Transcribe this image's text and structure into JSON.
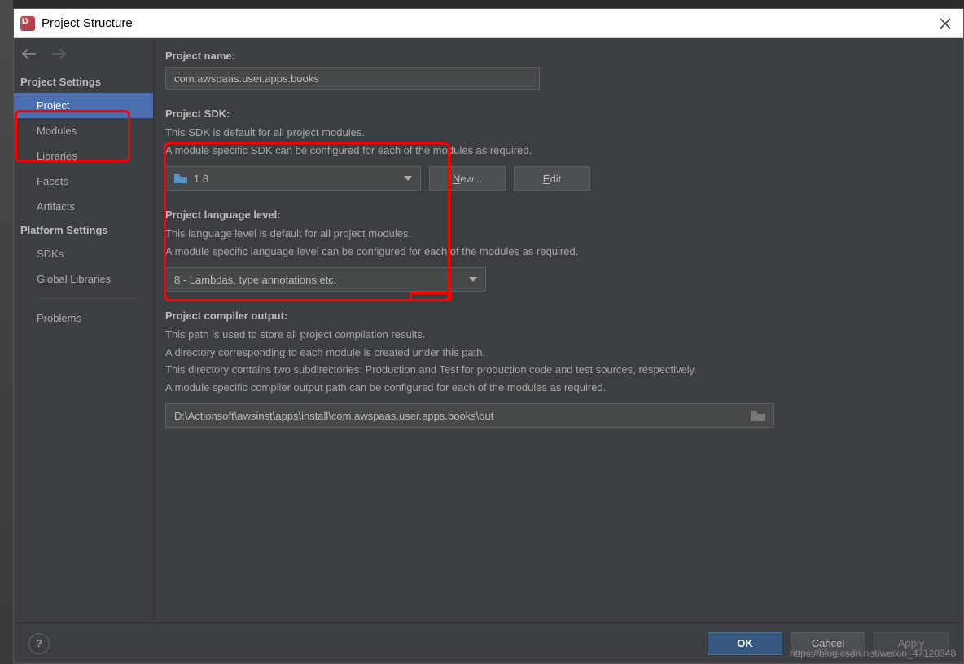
{
  "window": {
    "title": "Project Structure"
  },
  "sidebar": {
    "projectSettings": {
      "header": "Project Settings",
      "items": [
        {
          "label": "Project",
          "selected": true
        },
        {
          "label": "Modules",
          "selected": false
        },
        {
          "label": "Libraries",
          "selected": false
        },
        {
          "label": "Facets",
          "selected": false
        },
        {
          "label": "Artifacts",
          "selected": false
        }
      ]
    },
    "platformSettings": {
      "header": "Platform Settings",
      "items": [
        {
          "label": "SDKs",
          "selected": false
        },
        {
          "label": "Global Libraries",
          "selected": false
        }
      ]
    },
    "problems": {
      "label": "Problems"
    }
  },
  "main": {
    "projectName": {
      "label": "Project name:",
      "value": "com.awspaas.user.apps.books"
    },
    "projectSdk": {
      "label": "Project SDK:",
      "help1": "This SDK is default for all project modules.",
      "help2": "A module specific SDK can be configured for each of the modules as required.",
      "value": "1.8",
      "newBtn": "New...",
      "newMn": "N",
      "editBtn": "Edit",
      "editMn": "E"
    },
    "langLevel": {
      "label": "Project language level:",
      "help1": "This language level is default for all project modules.",
      "help2": "A module specific language level can be configured for each of the modules as required.",
      "value": "8 - Lambdas, type annotations etc."
    },
    "compilerOut": {
      "label": "Project compiler output:",
      "help1": "This path is used to store all project compilation results.",
      "help2": "A directory corresponding to each module is created under this path.",
      "help3": "This directory contains two subdirectories: Production and Test for production code and test sources, respectively.",
      "help4": "A module specific compiler output path can be configured for each of the modules as required.",
      "value": "D:\\Actionsoft\\awsinst\\apps\\install\\com.awspaas.user.apps.books\\out"
    }
  },
  "footer": {
    "ok": "OK",
    "cancel": "Cancel",
    "apply": "Apply"
  },
  "watermark": "https://blog.csdn.net/weixin_47120348"
}
